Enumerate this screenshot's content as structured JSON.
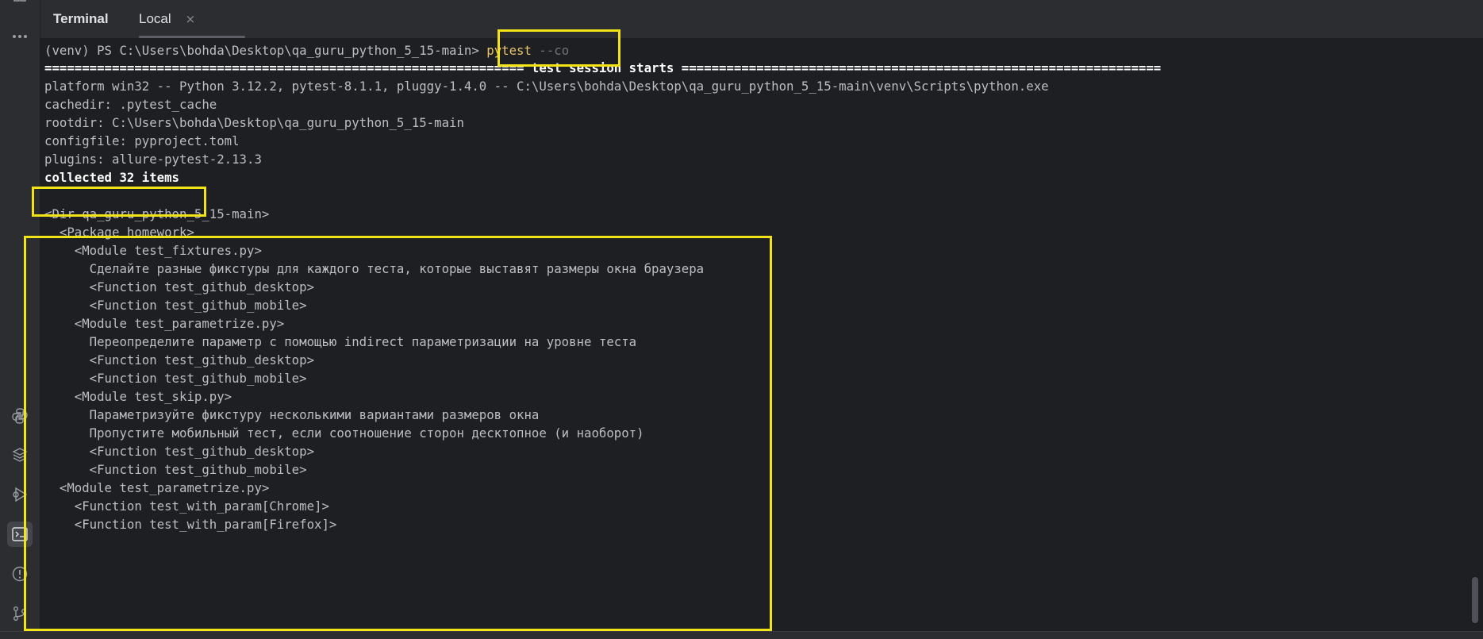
{
  "toolwindow": {
    "title": "Terminal",
    "tab": {
      "label": "Local",
      "close_glyph": "×"
    }
  },
  "sidebar_icons": [
    "layout-icon",
    "more-icon",
    "python-icon",
    "layers-icon",
    "run-icon",
    "terminal-icon",
    "problems-icon",
    "git-icon"
  ],
  "terminal": {
    "prompt": "(venv) PS C:\\Users\\bohda\\Desktop\\qa_guru_python_5_15-main>",
    "command": "pytest",
    "flag": "--co",
    "lines": [
      "================================================================ test session starts ================================================================",
      "platform win32 -- Python 3.12.2, pytest-8.1.1, pluggy-1.4.0 -- C:\\Users\\bohda\\Desktop\\qa_guru_python_5_15-main\\venv\\Scripts\\python.exe",
      "cachedir: .pytest_cache",
      "rootdir: C:\\Users\\bohda\\Desktop\\qa_guru_python_5_15-main",
      "configfile: pyproject.toml",
      "plugins: allure-pytest-2.13.3",
      "collected 32 items",
      "",
      "<Dir qa_guru_python_5_15-main>",
      "  <Package homework>",
      "    <Module test_fixtures.py>",
      "      Сделайте разные фикстуры для каждого теста, которые выставят размеры окна браузера",
      "      <Function test_github_desktop>",
      "      <Function test_github_mobile>",
      "    <Module test_parametrize.py>",
      "      Переопределите параметр с помощью indirect параметризации на уровне теста",
      "      <Function test_github_desktop>",
      "      <Function test_github_mobile>",
      "    <Module test_skip.py>",
      "      Параметризуйте фикстуру несколькими вариантами размеров окна",
      "      Пропустите мобильный тест, если соотношение сторон десктопное (и наоборот)",
      "      <Function test_github_desktop>",
      "      <Function test_github_mobile>",
      "  <Module test_parametrize.py>",
      "    <Function test_with_param[Chrome]>",
      "    <Function test_with_param[Firefox]>"
    ]
  },
  "colors": {
    "background": "#1e1f22",
    "panel": "#2b2d30",
    "text": "#bcbec4",
    "command": "#e8c46b",
    "highlight": "#f2e318"
  }
}
